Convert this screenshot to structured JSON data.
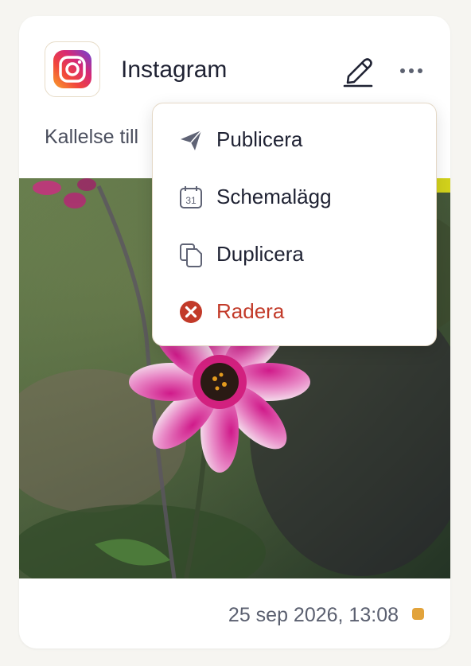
{
  "post": {
    "platform": "Instagram",
    "caption": "Kallelse till",
    "timestamp": "25 sep 2026, 13:08",
    "status_color": "#e2a33b"
  },
  "menu": {
    "items": [
      {
        "label": "Publicera",
        "icon": "send-icon"
      },
      {
        "label": "Schemalägg",
        "icon": "calendar-icon"
      },
      {
        "label": "Duplicera",
        "icon": "duplicate-icon"
      },
      {
        "label": "Radera",
        "icon": "delete-icon",
        "color": "#c23a29"
      }
    ]
  },
  "calendar_icon_text": "31"
}
